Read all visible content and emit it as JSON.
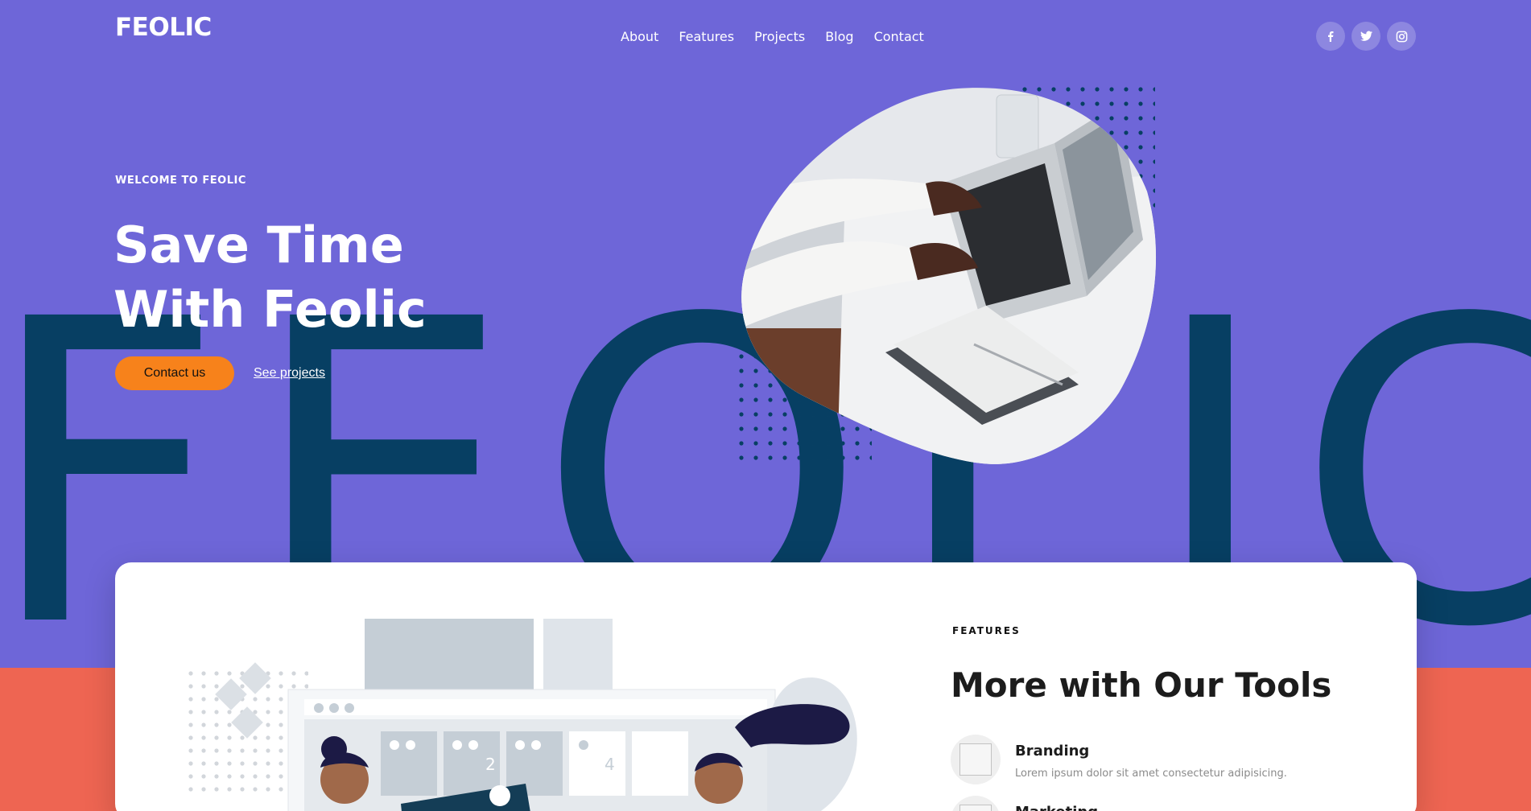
{
  "brand": {
    "logo": "FEOLIC",
    "background_word": "FEOLIC"
  },
  "nav": {
    "items": [
      "About",
      "Features",
      "Projects",
      "Blog",
      "Contact"
    ]
  },
  "social": {
    "icons": [
      "facebook-icon",
      "twitter-icon",
      "instagram-icon"
    ]
  },
  "hero": {
    "eyebrow": "WELCOME TO FEOLIC",
    "title_line1": "Save Time",
    "title_line2": "With Feolic",
    "primary_button": "Contact us",
    "secondary_link": "See projects"
  },
  "features": {
    "label": "FEATURES",
    "title": "More with Our Tools",
    "items": [
      {
        "name": "Branding",
        "desc": "Lorem ipsum dolor sit amet consectetur adipisicing."
      },
      {
        "name": "Marketing",
        "desc": ""
      }
    ]
  },
  "illustration": {
    "calendar_numbers": [
      "2",
      "4"
    ]
  },
  "colors": {
    "hero_bg": "#6e66d8",
    "accent": "#f7821b",
    "dark_word": "#073f63",
    "coral": "#ee6552"
  }
}
